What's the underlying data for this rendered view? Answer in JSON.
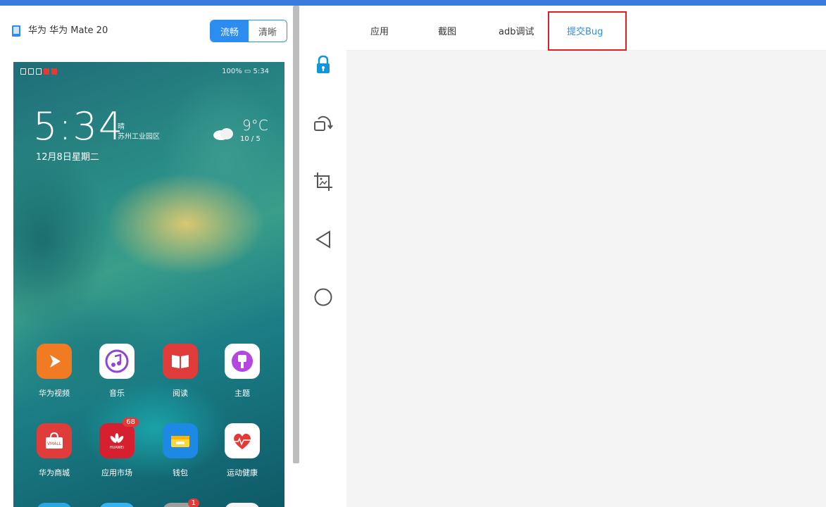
{
  "device": {
    "name": "华为 华为 Mate 20",
    "icon": "phone-icon",
    "quality_options": [
      "流畅",
      "清晰"
    ],
    "quality_selected": "流畅"
  },
  "phone_screen": {
    "status_right": "100% ▭ 5:34",
    "time": "5:34",
    "weather_desc": "晴",
    "location": "苏州工业园区",
    "date": "12月8日星期二",
    "temperature": "9°C",
    "temp_range": "10 / 5",
    "apps": [
      {
        "label": "华为视频",
        "icon": "video-icon",
        "color": "#f07b22"
      },
      {
        "label": "音乐",
        "icon": "music-icon",
        "color": "#ffffff"
      },
      {
        "label": "阅读",
        "icon": "book-icon",
        "color": "#e03c3c"
      },
      {
        "label": "主题",
        "icon": "theme-brush-icon",
        "color": "#ffffff"
      },
      {
        "label": "华为商城",
        "icon": "vmall-icon",
        "color": "#e03c3c",
        "text": "VMALL"
      },
      {
        "label": "应用市场",
        "icon": "appgallery-icon",
        "color": "#d7202f",
        "text": "HUAWEI",
        "badge": "68"
      },
      {
        "label": "钱包",
        "icon": "wallet-icon",
        "color": "#1e88e5"
      },
      {
        "label": "运动健康",
        "icon": "health-heart-icon",
        "color": "#ffffff"
      }
    ],
    "dock_badge": "1"
  },
  "toolbar": [
    {
      "name": "lock-icon",
      "label": "lock"
    },
    {
      "name": "rotate-icon",
      "label": "rotate"
    },
    {
      "name": "screenshot-crop-icon",
      "label": "screenshot"
    },
    {
      "name": "back-triangle-icon",
      "label": "back"
    },
    {
      "name": "home-circle-icon",
      "label": "home"
    }
  ],
  "tabs": [
    {
      "label": "应用"
    },
    {
      "label": "截图"
    },
    {
      "label": "adb调试"
    },
    {
      "label": "提交Bug",
      "active": true
    }
  ],
  "colors": {
    "accent": "#2d8cf0",
    "top_bar": "#3a7bdc",
    "highlight_box": "#e02020",
    "content_bg": "#f4f4f4"
  }
}
